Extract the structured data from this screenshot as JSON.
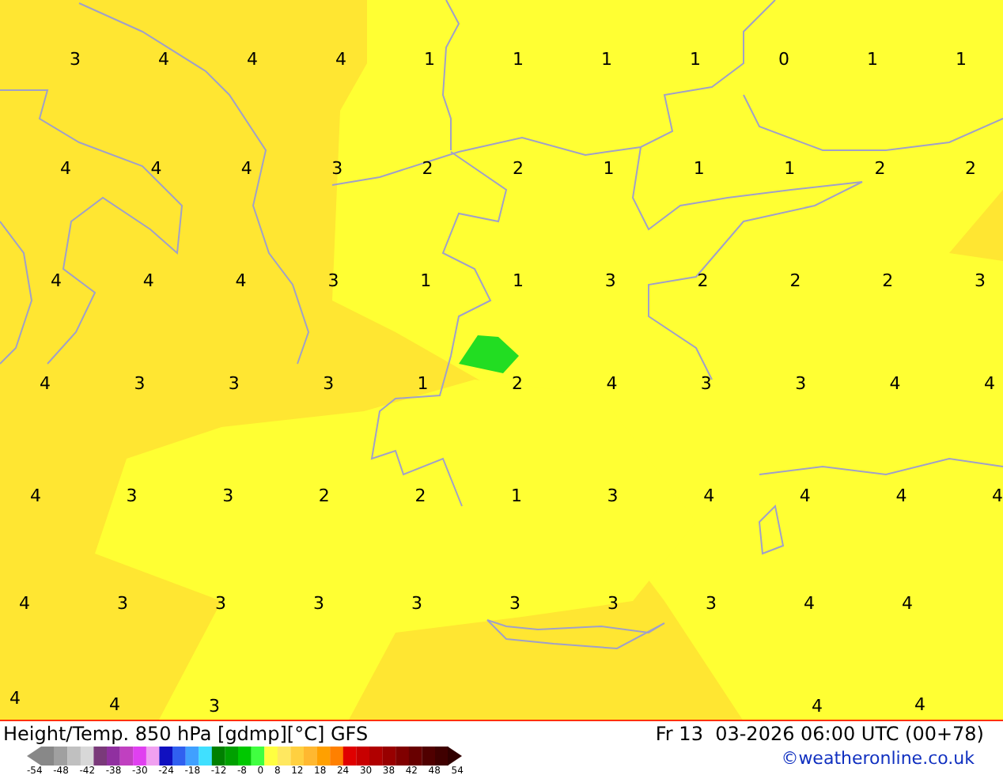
{
  "map": {
    "label_rows": [
      [
        "3",
        "4",
        "4",
        "4",
        "1",
        "1",
        "1",
        "1",
        "0",
        "1",
        "1"
      ],
      [
        "4",
        "4",
        "4",
        "3",
        "2",
        "2",
        "1",
        "1",
        "1",
        "2",
        "2"
      ],
      [
        "4",
        "4",
        "4",
        "3",
        "1",
        "1",
        "3",
        "2",
        "2",
        "2",
        "3"
      ],
      [
        "4",
        "3",
        "3",
        "3",
        "1",
        "2",
        "4",
        "3",
        "3",
        "4",
        "4"
      ],
      [
        "4",
        "3",
        "3",
        "2",
        "2",
        "1",
        "3",
        "4",
        "4",
        "4",
        "4"
      ],
      [
        "4",
        "3",
        "3",
        "3",
        "3",
        "3",
        "3",
        "3",
        "4",
        "4"
      ],
      [
        "4",
        "4",
        "3",
        "4",
        "4"
      ]
    ]
  },
  "footer": {
    "title": "Height/Temp. 850 hPa [gdmp][°C] GFS",
    "datetime": "Fr 13  03-2026 06:00 UTC (00+78)",
    "copyright": "©weatheronline.co.uk",
    "scale_ticks": [
      "-54",
      "-48",
      "-42",
      "-38",
      "-30",
      "-24",
      "-18",
      "-12",
      "-8",
      "0",
      "8",
      "12",
      "18",
      "24",
      "30",
      "38",
      "42",
      "48",
      "54"
    ]
  }
}
